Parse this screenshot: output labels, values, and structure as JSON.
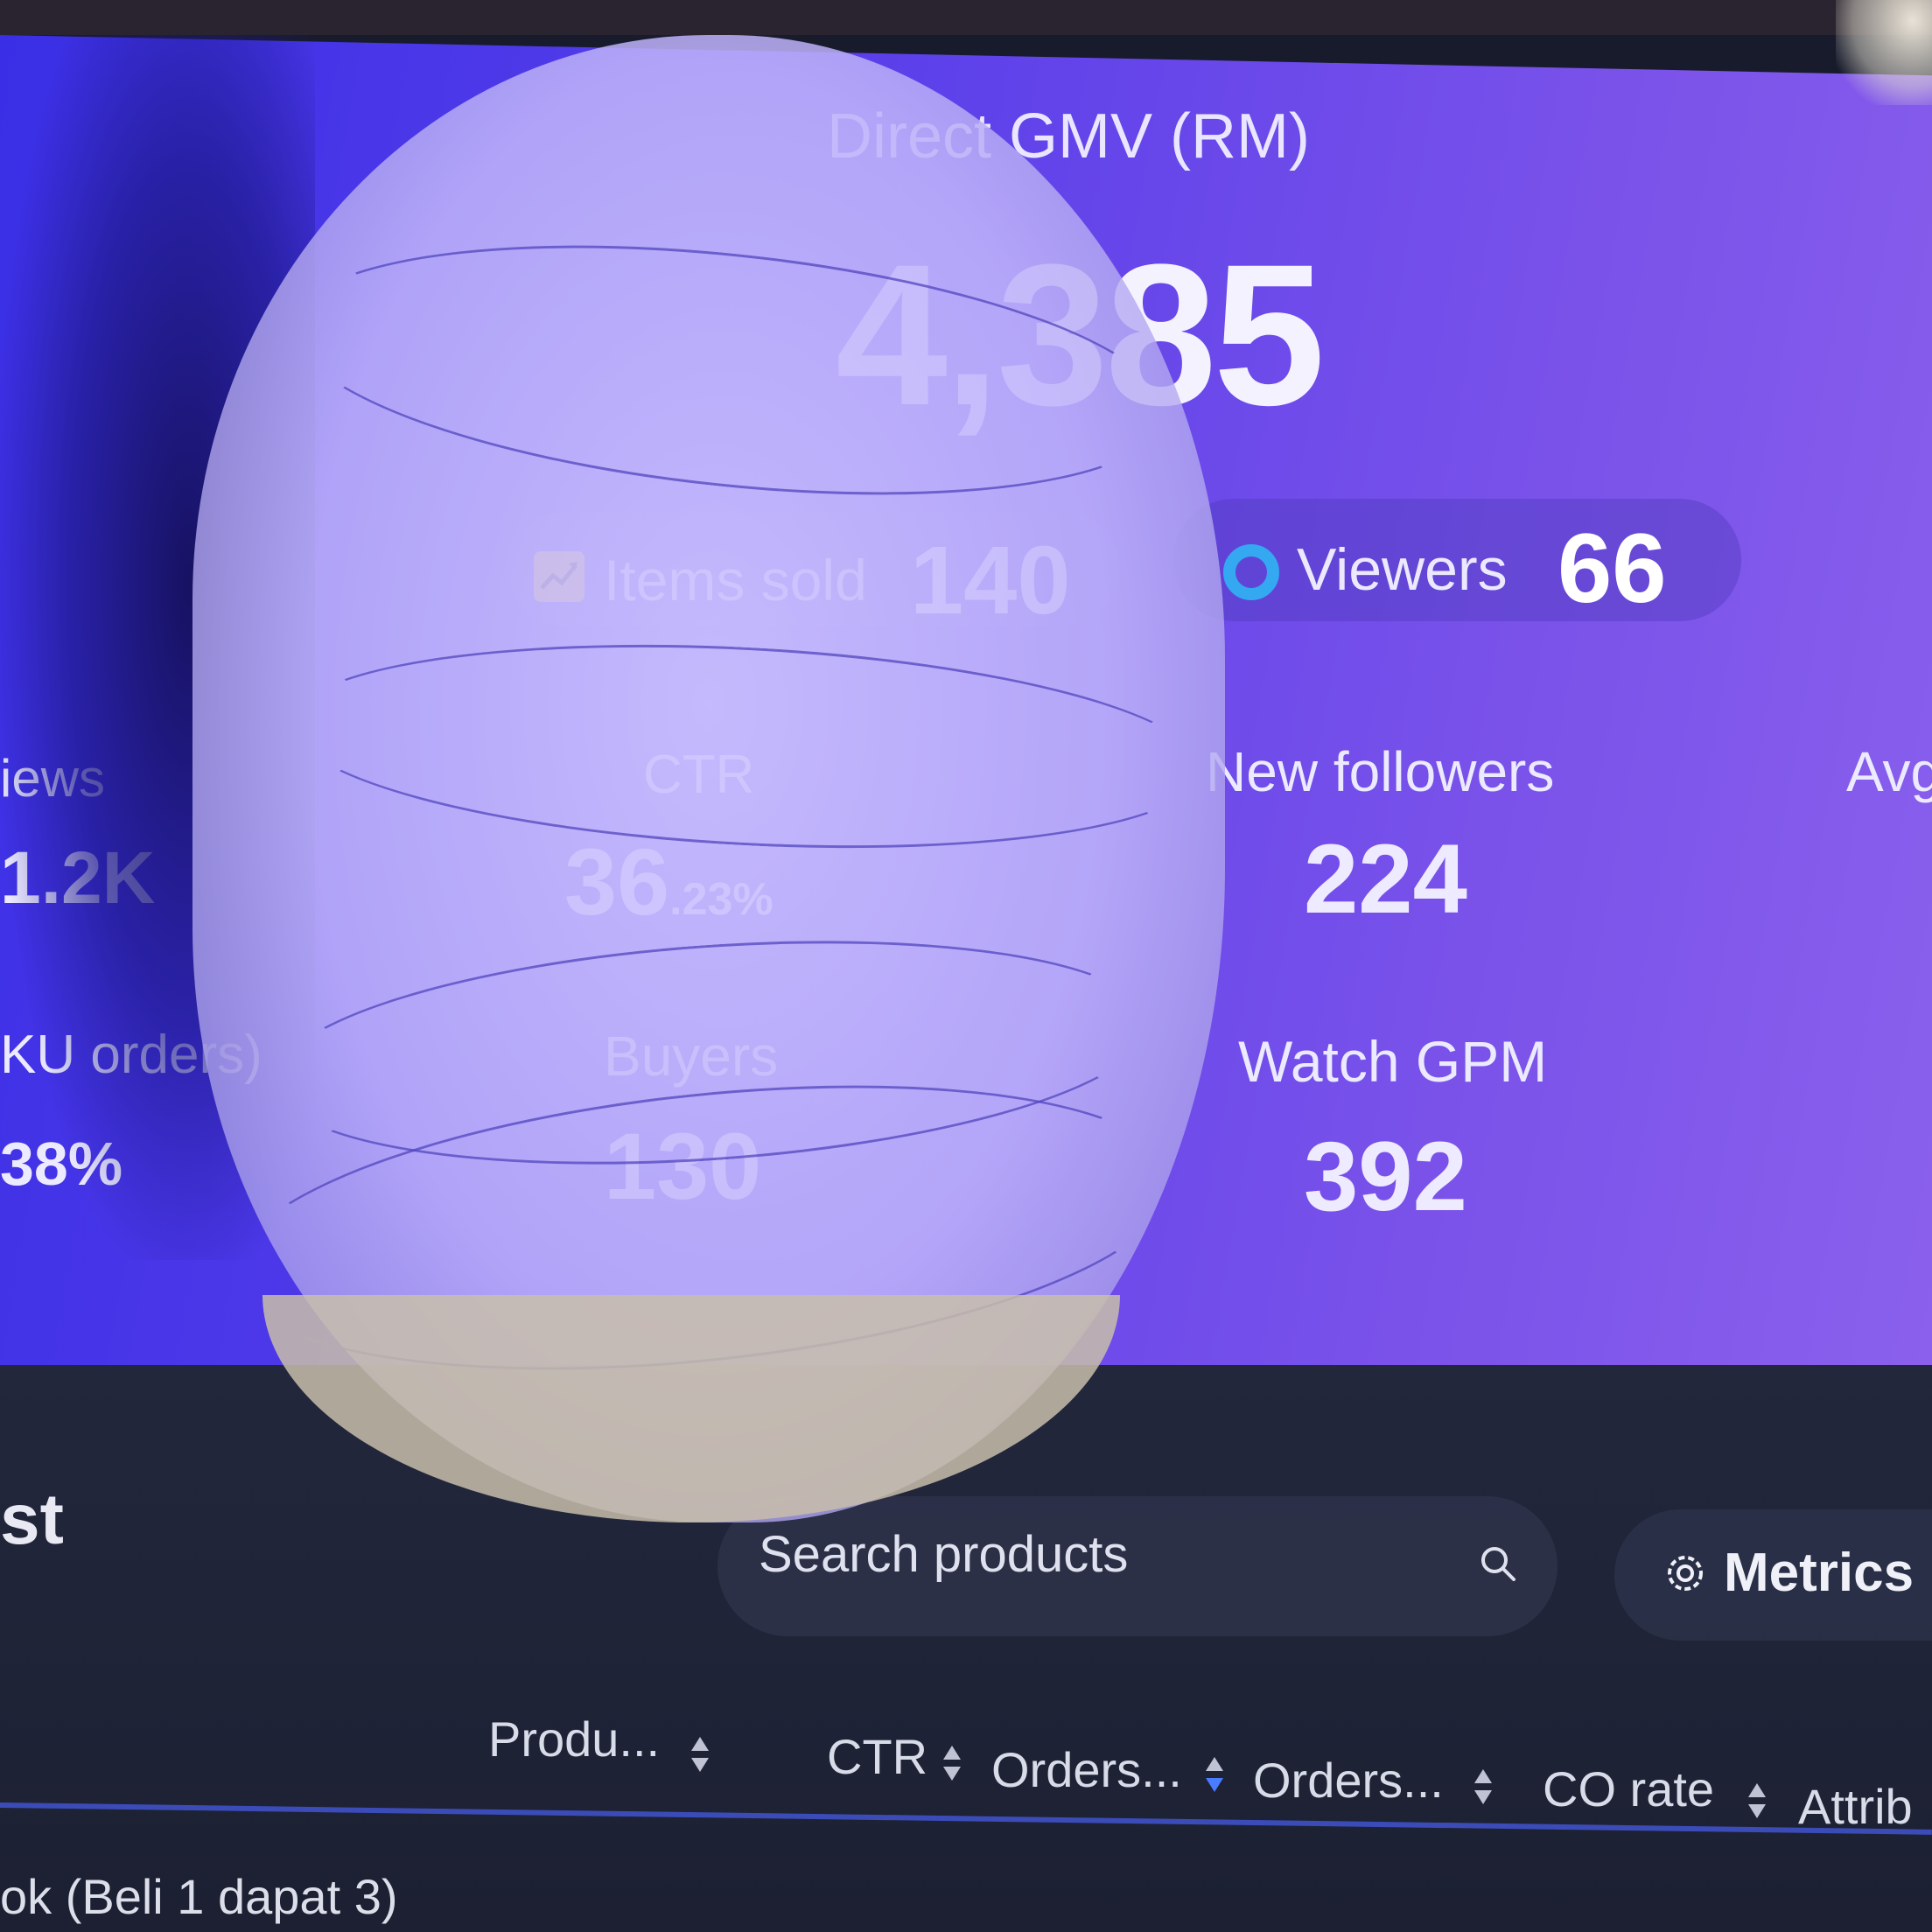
{
  "summary": {
    "gmv_label": "Direct GMV (RM)",
    "gmv_value": "4,385",
    "items_sold_label": "Items sold",
    "items_sold_value": "140",
    "viewers_label": "Viewers",
    "viewers_value": "66"
  },
  "metrics": {
    "views_label": "iews",
    "views_value": "1.2K",
    "ctr_label": "CTR",
    "ctr_value_main": "36",
    "ctr_value_suffix": ".23%",
    "new_followers_label": "New followers",
    "new_followers_value": "224",
    "avg_label": "Avg",
    "sku_label": "KU orders)",
    "sku_value": "38%",
    "buyers_label": "Buyers",
    "buyers_value": "130",
    "watch_gpm_label": "Watch GPM",
    "watch_gpm_value": "392"
  },
  "product_list": {
    "title": "st",
    "search_placeholder": "Search products",
    "metrics_button": "Metrics",
    "columns": [
      "Produ...",
      "CTR",
      "Orders...",
      "Orders...",
      "CO rate",
      "Attrib"
    ],
    "first_row_text": "ok   (Beli 1 dapat 3)"
  },
  "colors": {
    "panel_start": "#3a2fe6",
    "panel_end": "#8a60ec",
    "items_icon": "#f0c548",
    "viewers_icon": "#34a8f0",
    "sort_active": "#4a7cff"
  },
  "icons": [
    "trend-up-icon",
    "viewers-ring-icon",
    "search-icon",
    "gear-icon",
    "sort-icon"
  ]
}
